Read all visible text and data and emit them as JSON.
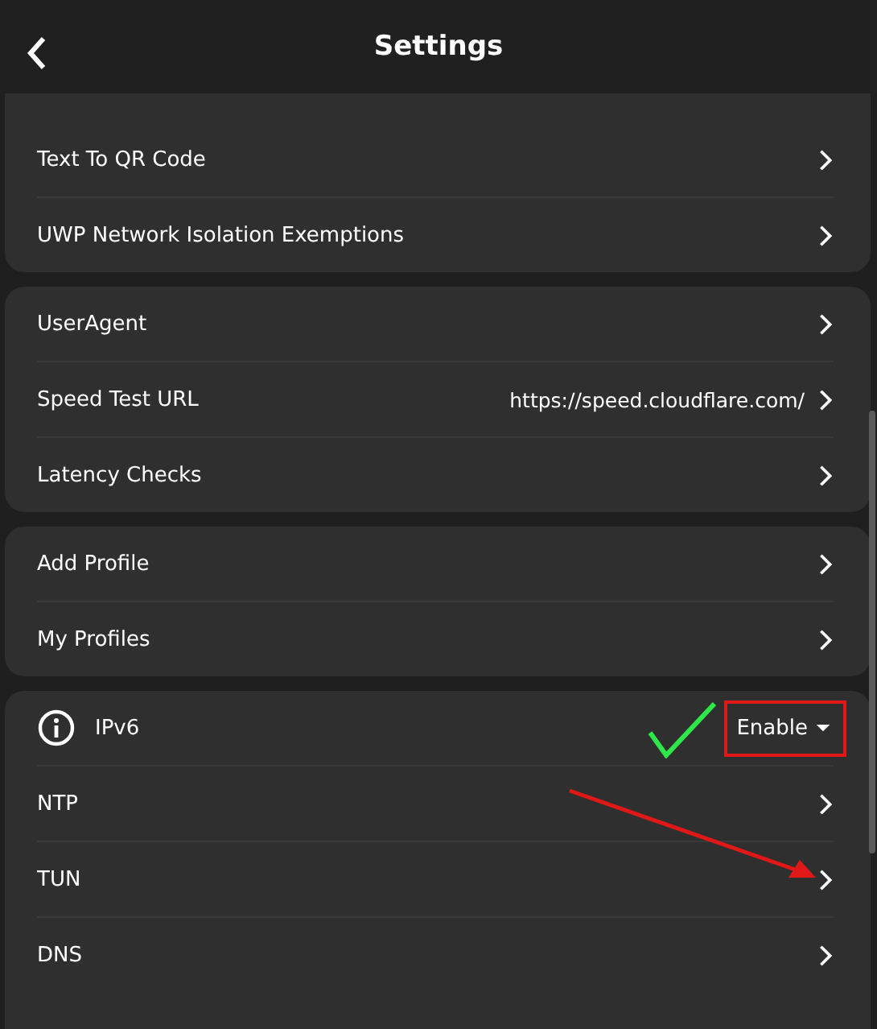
{
  "header": {
    "title": "Settings"
  },
  "groups": [
    {
      "rows": [
        {
          "kind": "link",
          "label": "Text To QR Code"
        },
        {
          "kind": "link",
          "label": "UWP Network Isolation Exemptions"
        }
      ]
    },
    {
      "rows": [
        {
          "kind": "link",
          "label": "UserAgent"
        },
        {
          "kind": "value",
          "label": "Speed Test URL",
          "value": "https://speed.cloudflare.com/"
        },
        {
          "kind": "link",
          "label": "Latency Checks"
        }
      ]
    },
    {
      "rows": [
        {
          "kind": "link",
          "label": "Add Profile"
        },
        {
          "kind": "link",
          "label": "My Profiles"
        }
      ]
    },
    {
      "rows": [
        {
          "kind": "dropdown",
          "label": "IPv6",
          "value": "Enable"
        },
        {
          "kind": "link",
          "label": "NTP"
        },
        {
          "kind": "link",
          "label": "TUN"
        },
        {
          "kind": "link",
          "label": "DNS"
        }
      ]
    }
  ]
}
